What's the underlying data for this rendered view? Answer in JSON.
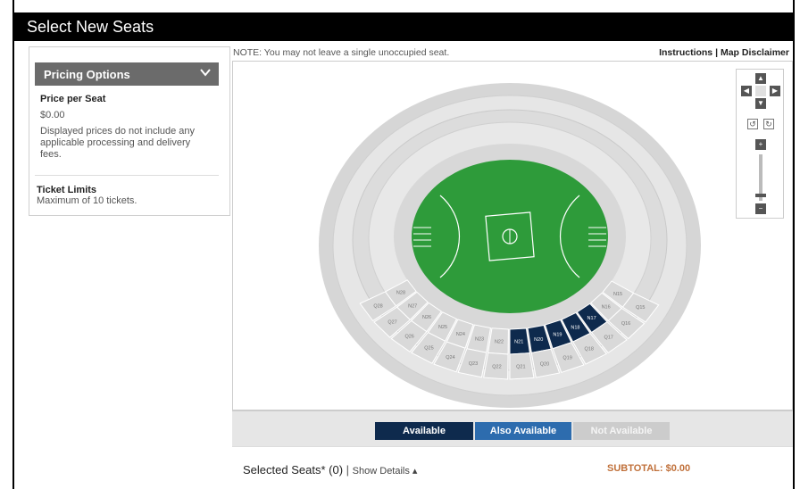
{
  "title": "Select New Seats",
  "pricing": {
    "header": "Pricing Options",
    "price_label": "Price per Seat",
    "price_value": "$0.00",
    "price_note": "Displayed prices do not include any applicable processing and delivery fees.",
    "limits_label": "Ticket Limits",
    "limits_value": "Maximum of 10 tickets."
  },
  "note": "NOTE: You may not leave a single unoccupied seat.",
  "links": {
    "instructions": "Instructions",
    "separator": "|",
    "disclaimer": "Map Disclaimer"
  },
  "map": {
    "sections_row_n": [
      "N28",
      "N27",
      "N26",
      "N25",
      "N24",
      "N23",
      "N22",
      "N21",
      "N20",
      "N19",
      "N18",
      "N17",
      "N16",
      "N15"
    ],
    "sections_row_q": [
      "Q28",
      "Q27",
      "Q26",
      "Q25",
      "Q24",
      "Q23",
      "Q22",
      "Q21",
      "Q20",
      "Q19",
      "Q18",
      "Q17",
      "Q16",
      "Q15"
    ],
    "available_sections": [
      "N21",
      "N20",
      "N19",
      "N18",
      "N17"
    ],
    "colors": {
      "available": "#0e2a4d",
      "also_available": "#2d6cae",
      "not_available": "#cccccc",
      "field": "#2e9b3a"
    }
  },
  "legend": {
    "available": "Available",
    "also_available": "Also Available",
    "not_available": "Not Available"
  },
  "selected": {
    "label": "Selected Seats*",
    "count": "(0)",
    "sep": "|",
    "show_details": "Show Details ▴",
    "subtotal": "SUBTOTAL: $0.00"
  },
  "controls": {
    "up": "▲",
    "down": "▼",
    "left": "◀",
    "right": "▶",
    "rotate_left": "↺",
    "rotate_right": "↻",
    "zoom_in": "+",
    "zoom_out": "−"
  }
}
